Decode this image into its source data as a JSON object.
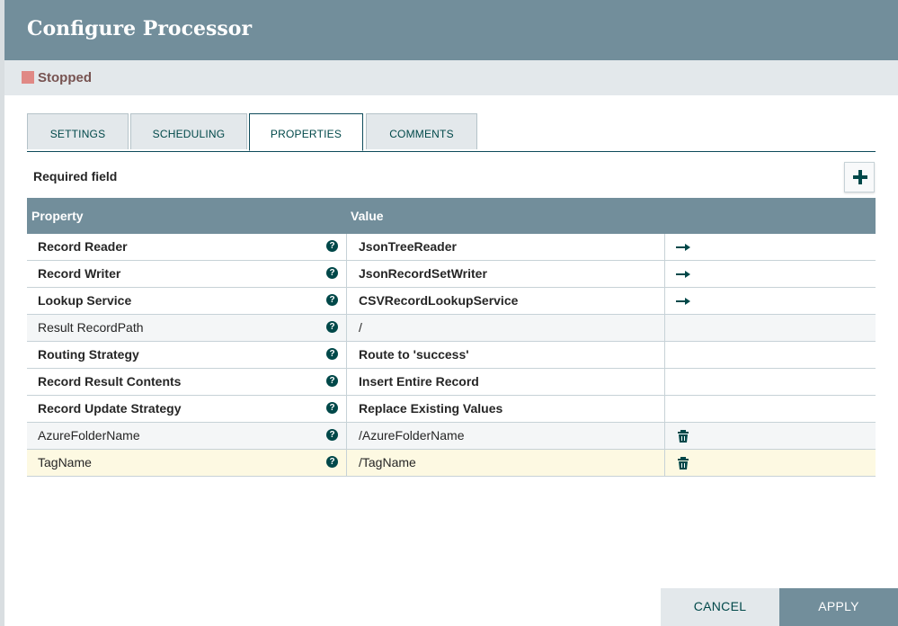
{
  "dialog": {
    "title": "Configure Processor"
  },
  "status": {
    "label": "Stopped",
    "color": "#e08985"
  },
  "tabs": [
    {
      "label": "SETTINGS",
      "active": false
    },
    {
      "label": "SCHEDULING",
      "active": false
    },
    {
      "label": "PROPERTIES",
      "active": true
    },
    {
      "label": "COMMENTS",
      "active": false
    }
  ],
  "properties": {
    "required_label": "Required field",
    "add_icon": "plus-icon",
    "columns": {
      "property": "Property",
      "value": "Value"
    },
    "rows": [
      {
        "name": "Record Reader",
        "value": "JsonTreeReader",
        "required": true,
        "action": "arrow"
      },
      {
        "name": "Record Writer",
        "value": "JsonRecordSetWriter",
        "required": true,
        "action": "arrow"
      },
      {
        "name": "Lookup Service",
        "value": "CSVRecordLookupService",
        "required": true,
        "action": "arrow"
      },
      {
        "name": "Result RecordPath",
        "value": "/",
        "required": false,
        "action": ""
      },
      {
        "name": "Routing Strategy",
        "value": "Route to 'success'",
        "required": true,
        "action": ""
      },
      {
        "name": "Record Result Contents",
        "value": "Insert Entire Record",
        "required": true,
        "action": ""
      },
      {
        "name": "Record Update Strategy",
        "value": "Replace Existing Values",
        "required": true,
        "action": ""
      },
      {
        "name": "AzureFolderName",
        "value": "/AzureFolderName",
        "required": false,
        "action": "delete"
      },
      {
        "name": "TagName",
        "value": "/TagName",
        "required": false,
        "action": "delete",
        "highlighted": true
      }
    ]
  },
  "footer": {
    "cancel_label": "CANCEL",
    "apply_label": "APPLY"
  },
  "colors": {
    "header": "#728e9b",
    "accent": "#004849",
    "row_alt": "#f4f6f7",
    "row_highlight": "#fdf9e2"
  }
}
